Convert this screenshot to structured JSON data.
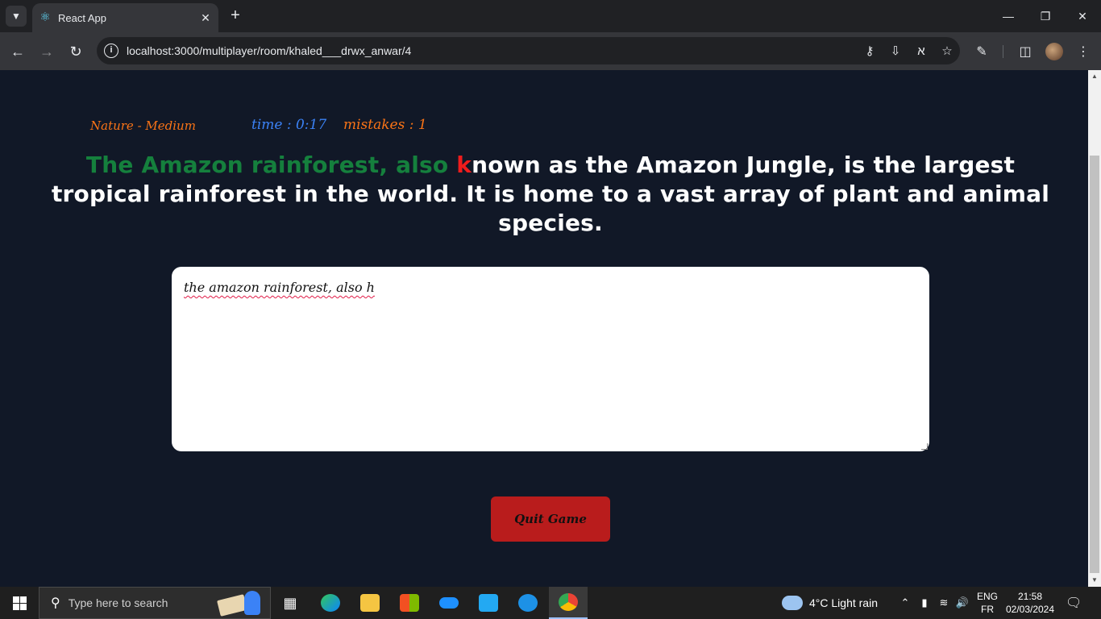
{
  "browser": {
    "tab_menu_icon": "chevron-down-icon",
    "tab_title": "React App",
    "tab_favicon": "react-icon",
    "url": "localhost:3000/multiplayer/room/khaled___drwx_anwar/4"
  },
  "game": {
    "category": "Nature - Medium",
    "timer": "time : 0:17",
    "mistakes": "mistakes : 1",
    "passage_correct": "The Amazon rainforest, also ",
    "passage_error": "k",
    "passage_rest": "nown as the Amazon Jungle, is the largest tropical rainforest in the world. It is home to a vast array of plant and animal species.",
    "typed_text": "the amazon rainforest, also h",
    "quit_label": "Quit Game"
  },
  "taskbar": {
    "search_placeholder": "Type here to search",
    "weather": "4°C  Light rain",
    "lang_top": "ENG",
    "lang_bottom": "FR",
    "time": "21:58",
    "date": "02/03/2024"
  },
  "colors": {
    "page_bg": "#111827",
    "correct": "#15803d",
    "error": "#ef1c1c",
    "category": "#f97316",
    "timer": "#3b82f6",
    "quit_button": "#b91c1c"
  }
}
